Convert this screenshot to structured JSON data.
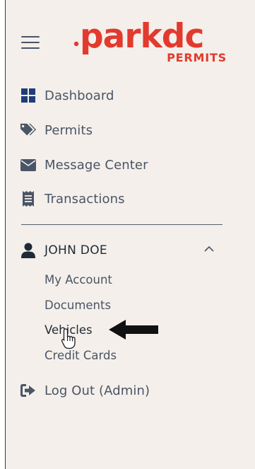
{
  "header": {
    "menu_icon": "hamburger-icon",
    "logo": {
      "main_text": "parkdc",
      "sub_text": "PERMITS",
      "color": "#e23a2e"
    }
  },
  "nav": {
    "items": [
      {
        "label": "Dashboard",
        "icon": "grid-icon"
      },
      {
        "label": "Permits",
        "icon": "tags-icon"
      },
      {
        "label": "Message Center",
        "icon": "envelope-icon"
      },
      {
        "label": "Transactions",
        "icon": "receipt-icon"
      }
    ]
  },
  "user": {
    "name": "JOHN DOE",
    "icon": "user-icon",
    "expanded": true,
    "submenu": [
      {
        "label": "My Account"
      },
      {
        "label": "Documents"
      },
      {
        "label": "Vehicles",
        "active": true
      },
      {
        "label": "Credit Cards"
      }
    ]
  },
  "logout": {
    "label": "Log Out (Admin)",
    "icon": "sign-out-icon"
  },
  "colors": {
    "panel_bg": "#f4efea",
    "text": "#4a5566",
    "text_dark": "#1f2a36",
    "brand": "#e23a2e"
  }
}
